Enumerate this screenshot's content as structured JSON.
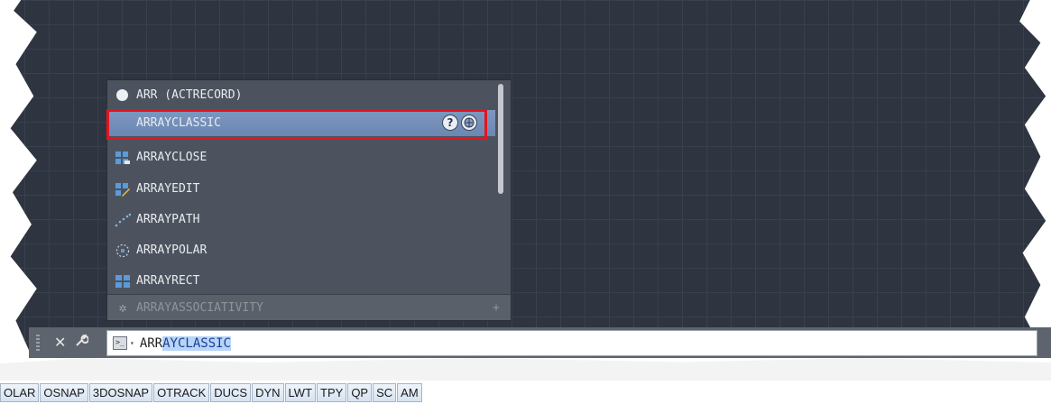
{
  "autocomplete": {
    "items": [
      {
        "label": "ARR (ACTRECORD)",
        "icon": "record-circle-icon"
      },
      {
        "label": "ARRAYCLASSIC",
        "icon": "none",
        "selected": true
      },
      {
        "label": "ARRAYCLOSE",
        "icon": "array-close-icon"
      },
      {
        "label": "ARRAYEDIT",
        "icon": "array-edit-icon"
      },
      {
        "label": "ARRAYPATH",
        "icon": "array-path-icon"
      },
      {
        "label": "ARRAYPOLAR",
        "icon": "array-polar-icon"
      },
      {
        "label": "ARRAYRECT",
        "icon": "array-rect-icon"
      }
    ],
    "selected_actions": {
      "help": "?",
      "web_search": "globe-icon"
    },
    "system_variable": {
      "label": "ARRAYASSOCIATIVITY",
      "icon": "gear-icon",
      "expand": "+"
    }
  },
  "command_line": {
    "close_glyph": "✕",
    "customize_glyph": "🔧",
    "prompt_icon": ">_",
    "prompt_arrow": "▾",
    "typed": "ARR",
    "completed": "AYCLASSIC"
  },
  "status_bar": {
    "buttons": [
      "OLAR",
      "OSNAP",
      "3DOSNAP",
      "OTRACK",
      "DUCS",
      "DYN",
      "LWT",
      "TPY",
      "QP",
      "SC",
      "AM"
    ]
  },
  "colors": {
    "canvas": "#2e3440",
    "selection": "#6b87b2",
    "highlight_frame": "#e8121f"
  }
}
